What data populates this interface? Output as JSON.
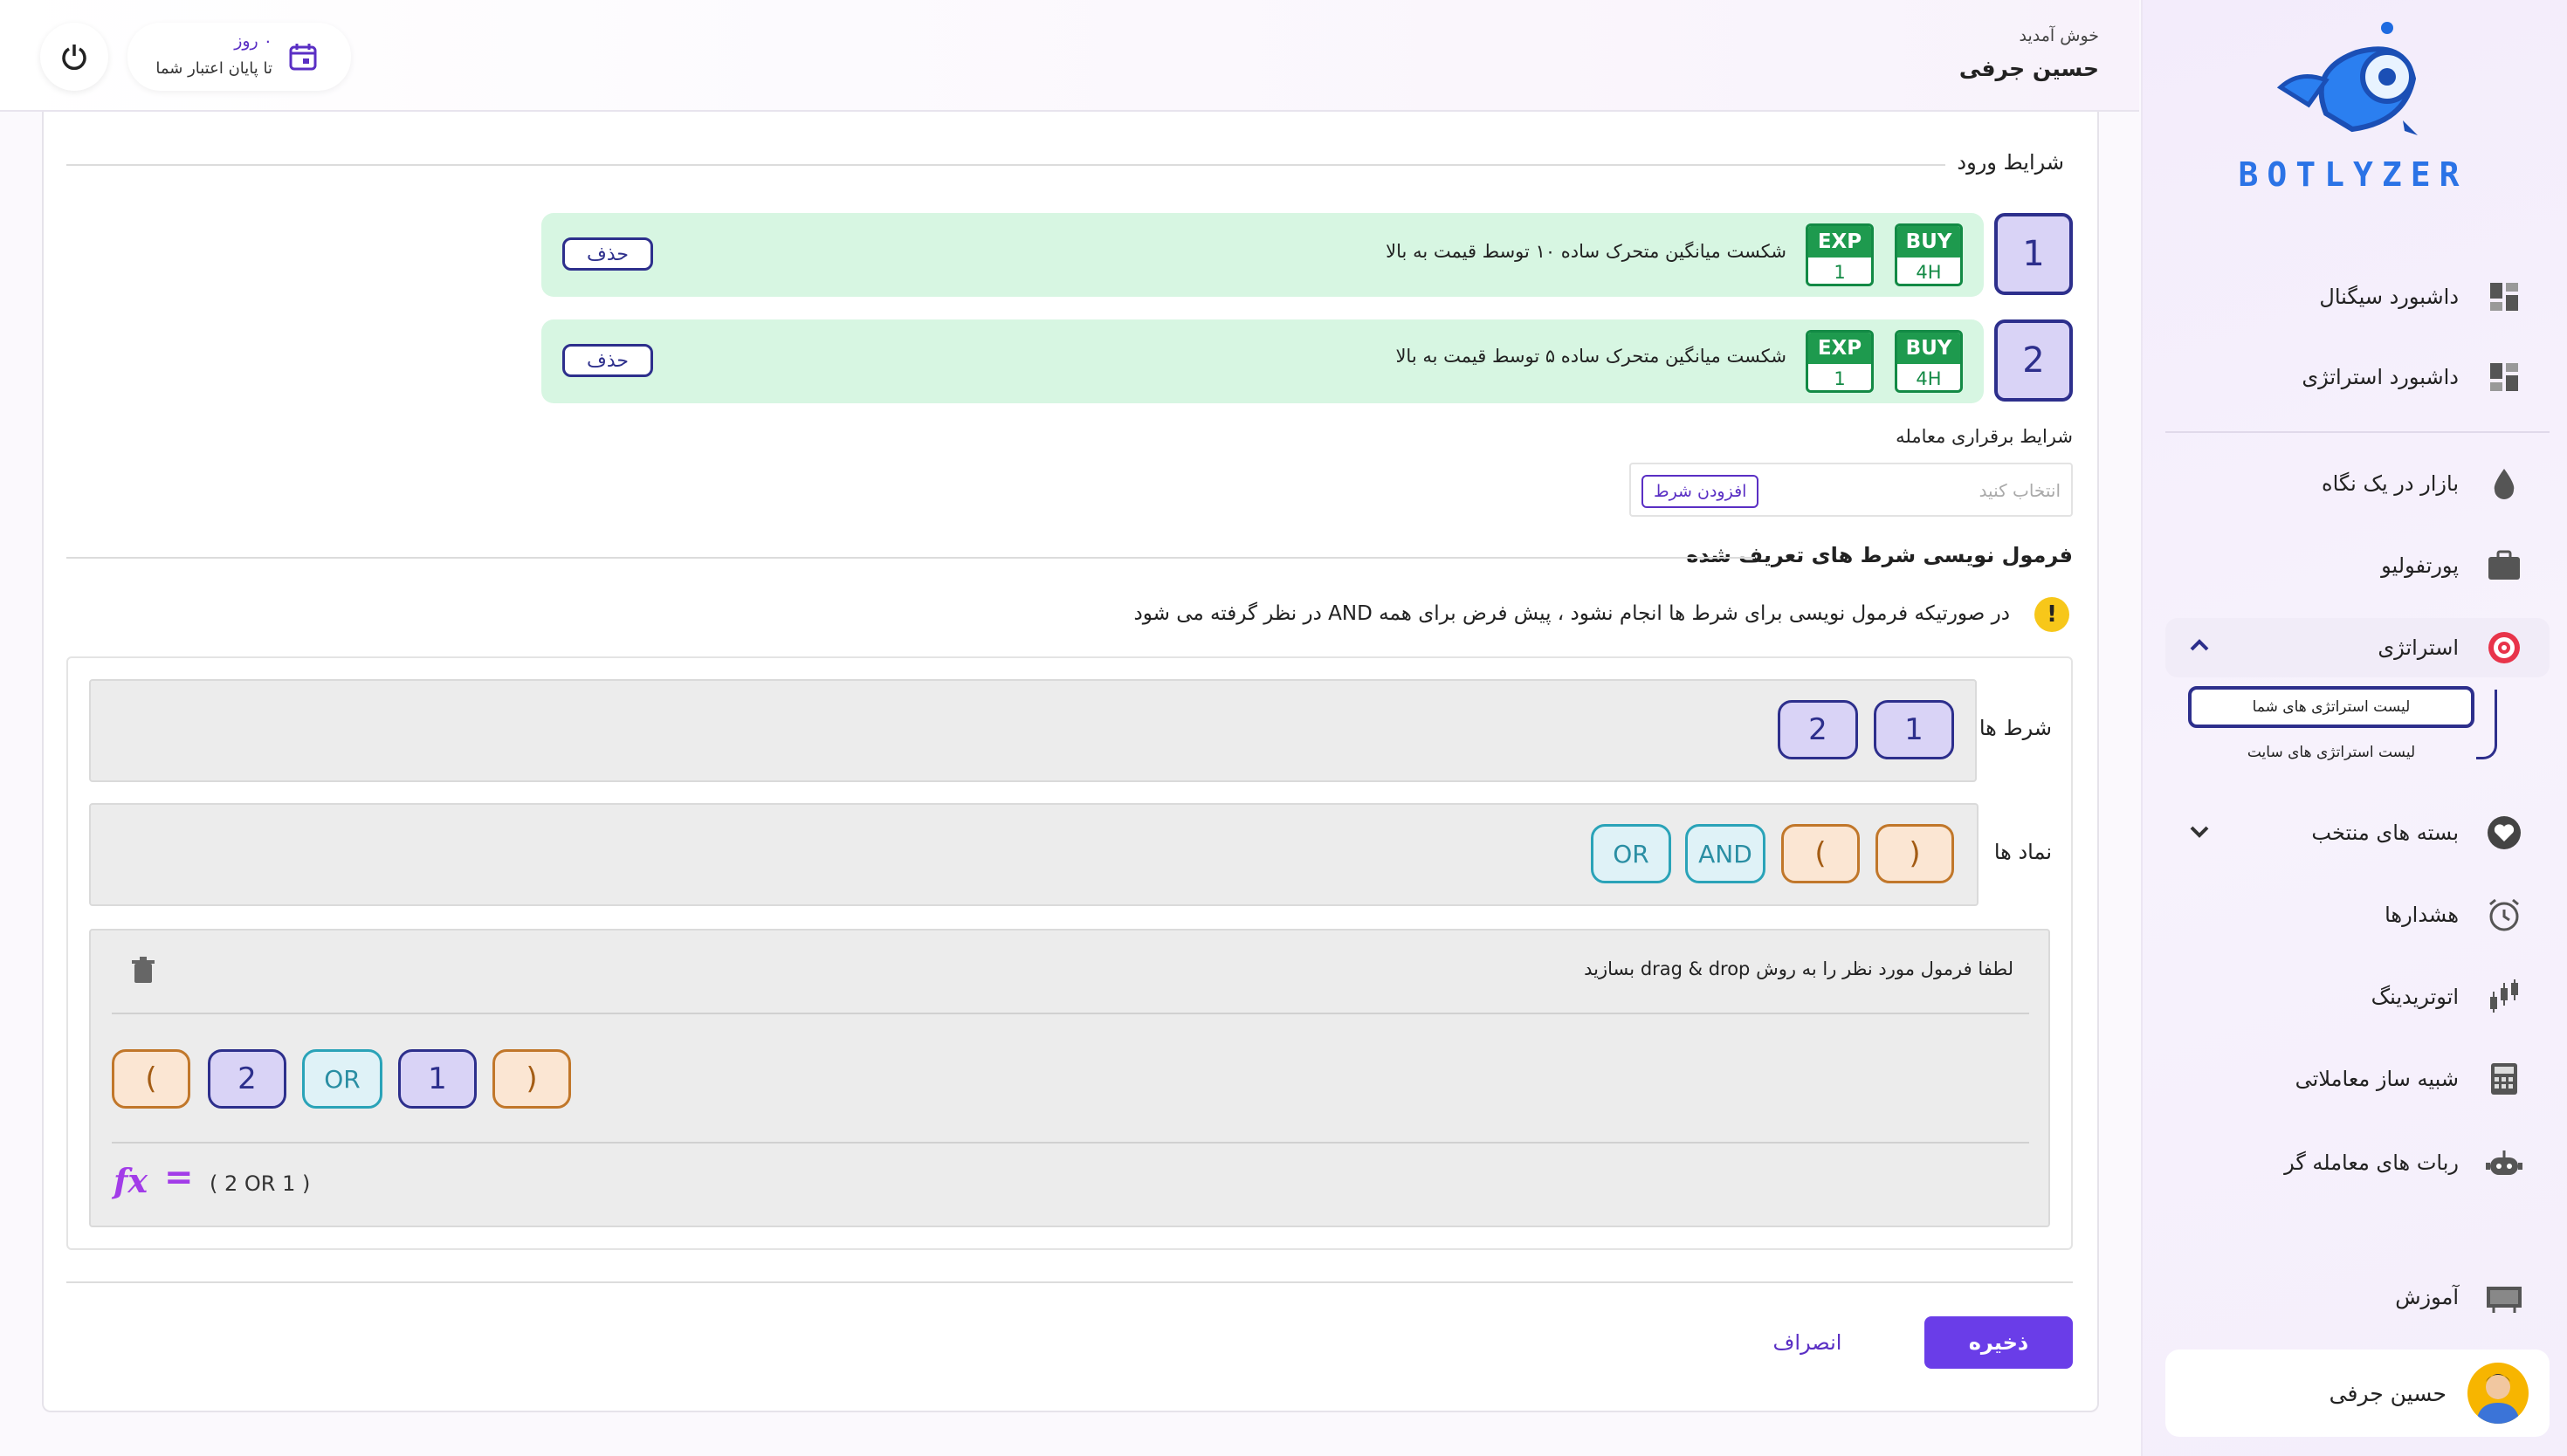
{
  "sidebar": {
    "brand": "BOTLYZER",
    "items": [
      {
        "label": "داشبورد سیگنال"
      },
      {
        "label": "داشبورد استراتژی"
      },
      {
        "label": "بازار در یک نگاه"
      },
      {
        "label": "پورتفولیو"
      },
      {
        "label": "استراتژی"
      },
      {
        "label": "بسته های منتخب"
      },
      {
        "label": "هشدارها"
      },
      {
        "label": "اتوتریدینگ"
      },
      {
        "label": "شبیه ساز معاملاتی"
      },
      {
        "label": "ربات های معامله گر"
      },
      {
        "label": "آموزش"
      }
    ],
    "sub_items": [
      {
        "label": "لیست استراتژی های شما"
      },
      {
        "label": "لیست استراتژی های سایت"
      }
    ],
    "user_name": "حسین جرفی"
  },
  "header": {
    "welcome": "خوش آمدید",
    "user_name": "حسین جرفی",
    "days": "۰ روز",
    "days_caption": "تا پایان اعتبار شما"
  },
  "entry": {
    "title": "شرایط ورود",
    "conditions": [
      {
        "num": "1",
        "side": "BUY",
        "timeframe": "4H",
        "exp_label": "EXP",
        "exp": "1",
        "text": "شکست میانگین متحرک ساده ۱۰ توسط قیمت به بالا",
        "delete": "حذف"
      },
      {
        "num": "2",
        "side": "BUY",
        "timeframe": "4H",
        "exp_label": "EXP",
        "exp": "1",
        "text": "شکست میانگین متحرک ساده ۵ توسط قیمت به بالا",
        "delete": "حذف"
      }
    ],
    "trade_conditions_label": "شرایط برقراری معامله",
    "select_placeholder": "انتخاب کنید",
    "add_condition": "افزودن شرط"
  },
  "formula": {
    "title": "فرمول نویسی شرط های تعریف شده",
    "notice": "در صورتیکه فرمول نویسی برای شرط ها انجام نشود ، پیش فرض برای همه AND در نظر گرفته می شود",
    "conditions_label": "شرط ها",
    "condition_chips": [
      "1",
      "2"
    ],
    "symbols_label": "نماد ها",
    "symbol_chips": [
      ")",
      "(",
      "AND",
      "OR"
    ],
    "drop_hint": "لطفا فرمول مورد نظر را به روش drag & drop بسازید",
    "built_chips": [
      ")",
      "1",
      "OR",
      "2",
      "("
    ],
    "fx": "fx",
    "equals": "=",
    "result": "( 2 OR 1 )"
  },
  "actions": {
    "save": "ذخیره",
    "cancel": "انصراف"
  },
  "colors": {
    "accent": "#6a3de8",
    "green": "#1e9a4e",
    "navy": "#2d2f8c"
  }
}
